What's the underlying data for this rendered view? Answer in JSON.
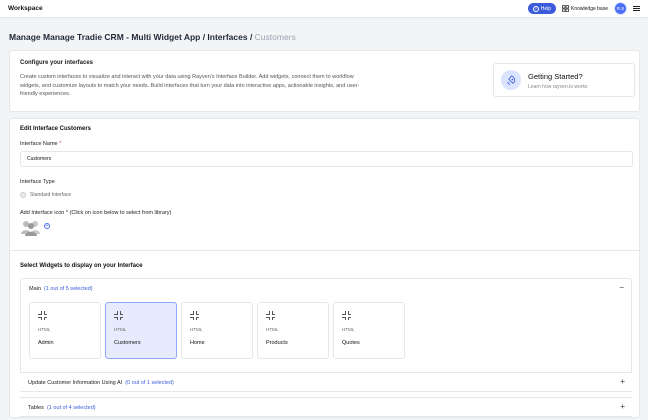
{
  "topbar": {
    "workspace": "Workspace",
    "help_label": "Help",
    "knowledge_base": "Knowledge base",
    "avatar_initials": "R.S"
  },
  "breadcrumb": {
    "part1": "Manage Manage Tradie CRM - Multi Widget App / Interfaces / ",
    "current": "Customers"
  },
  "configure": {
    "title": "Configure your interfaces",
    "description": "Create custom interfaces to visualize and interact with your data using Rayven's Interface Builder. Add widgets, connect them to workflow widgets, and customize layouts to match your needs. Build interfaces that turn your data into interactive apps, actionable insights, and user-friendly experiences.",
    "getting_started_title": "Getting Started?",
    "getting_started_link": "Learn how rayven.io works"
  },
  "edit": {
    "title": "Edit Interface Customers",
    "name_label": "Interface Name",
    "required_mark": "*",
    "name_value": "Customers",
    "type_label": "Interface Type",
    "type_option": "Standard Interface",
    "icon_label": "Add Interface icon * (Click on icon below to select from library)"
  },
  "widgets": {
    "title": "Select Widgets to display on your Interface",
    "groups": [
      {
        "label": "Main",
        "count": "(1 out of 5 selected)",
        "toggle": "−"
      },
      {
        "label": "Update Customer Information Using AI",
        "count": "(0 out of 1 selected)",
        "toggle": "+"
      },
      {
        "label": "Tables",
        "count": "(1 out of 4 selected)",
        "toggle": "+"
      }
    ],
    "tiles": [
      {
        "type": "HTML",
        "name": "Admin"
      },
      {
        "type": "HTML",
        "name": "Customers"
      },
      {
        "type": "HTML",
        "name": "Home"
      },
      {
        "type": "HTML",
        "name": "Products"
      },
      {
        "type": "HTML",
        "name": "Quotes"
      }
    ]
  },
  "colors": {
    "accent": "#3b5bdb",
    "selected_tile": "#e7ebfd"
  }
}
